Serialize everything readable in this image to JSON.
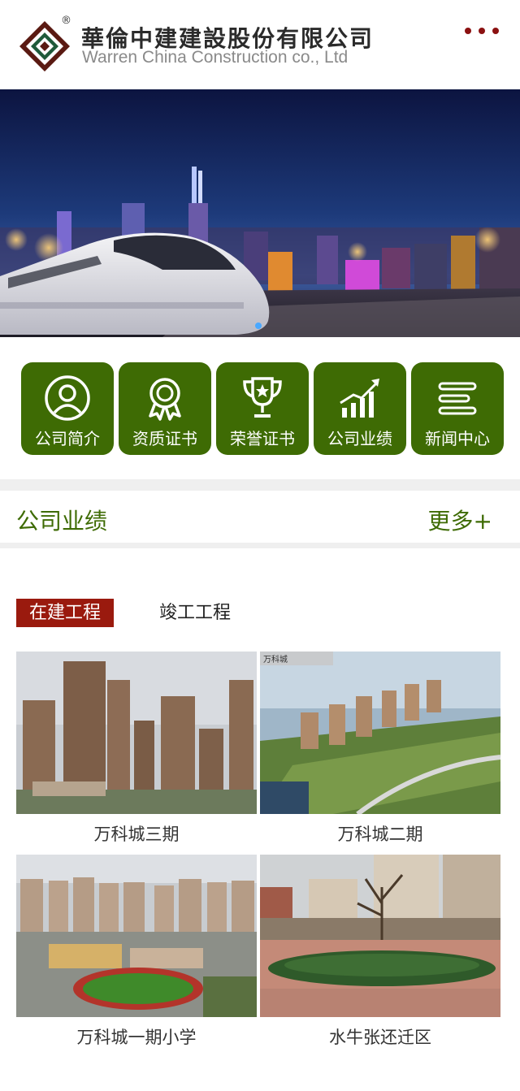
{
  "header": {
    "company_cn": "華倫中建建設股份有限公司",
    "company_en": "Warren China Construction co., Ltd",
    "reg_symbol": "®",
    "logo_icon": "diamond-logo-icon",
    "menu_icon": "more-dots-icon",
    "brand_color": "#8b1111"
  },
  "banner": {
    "description_icon": "bullet-train-city-night-image"
  },
  "quick_nav": {
    "tile_color": "#3e6b04",
    "items": [
      {
        "label": "公司简介",
        "icon": "user-profile-icon"
      },
      {
        "label": "资质证书",
        "icon": "award-badge-icon"
      },
      {
        "label": "荣誉证书",
        "icon": "trophy-icon"
      },
      {
        "label": "公司业绩",
        "icon": "growth-chart-icon"
      },
      {
        "label": "新闻中心",
        "icon": "news-lines-icon"
      }
    ]
  },
  "section": {
    "title": "公司业绩",
    "more": "更多+",
    "accent": "#3e6b04"
  },
  "tabs": {
    "active": "在建工程",
    "inactive": "竣工工程",
    "active_color": "#9a1a0e"
  },
  "projects": [
    {
      "caption": "万科城三期",
      "image_tag": ""
    },
    {
      "caption": "万科城二期",
      "image_tag": "万科城"
    },
    {
      "caption": "万科城一期小学",
      "image_tag": ""
    },
    {
      "caption": "水牛张还迁区",
      "image_tag": ""
    }
  ]
}
